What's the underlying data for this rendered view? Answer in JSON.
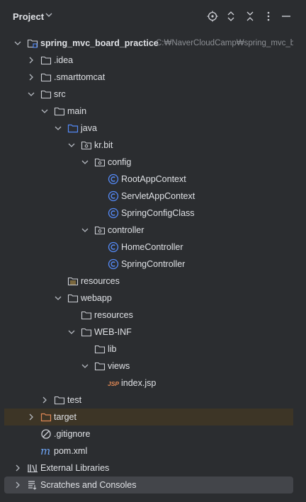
{
  "header": {
    "title": "Project",
    "icons": [
      "locate-icon",
      "expand-collapse-icon",
      "collapse-all-icon",
      "more-options-icon",
      "minimize-icon"
    ]
  },
  "tree": [
    {
      "label": "spring_mvc_board_practice",
      "path": "C:₩NaverCloudCamp₩spring_mvc_board_practice",
      "icon": "module-folder-icon",
      "arrow": "down",
      "depth": 0,
      "bold": true
    },
    {
      "label": ".idea",
      "icon": "folder-icon",
      "arrow": "right",
      "depth": 1
    },
    {
      "label": ".smarttomcat",
      "icon": "folder-icon",
      "arrow": "right",
      "depth": 1
    },
    {
      "label": "src",
      "icon": "folder-icon",
      "arrow": "down",
      "depth": 1
    },
    {
      "label": "main",
      "icon": "folder-icon",
      "arrow": "down",
      "depth": 2
    },
    {
      "label": "java",
      "icon": "source-folder-icon",
      "arrow": "down",
      "depth": 3
    },
    {
      "label": "kr.bit",
      "icon": "package-icon",
      "arrow": "down",
      "depth": 4
    },
    {
      "label": "config",
      "icon": "package-icon",
      "arrow": "down",
      "depth": 5
    },
    {
      "label": "RootAppContext",
      "icon": "class-icon",
      "arrow": "none",
      "depth": 6
    },
    {
      "label": "ServletAppContext",
      "icon": "class-icon",
      "arrow": "none",
      "depth": 6
    },
    {
      "label": "SpringConfigClass",
      "icon": "class-icon",
      "arrow": "none",
      "depth": 6
    },
    {
      "label": "controller",
      "icon": "package-icon",
      "arrow": "down",
      "depth": 5
    },
    {
      "label": "HomeController",
      "icon": "class-icon",
      "arrow": "none",
      "depth": 6
    },
    {
      "label": "SpringController",
      "icon": "class-icon",
      "arrow": "none",
      "depth": 6
    },
    {
      "label": "resources",
      "icon": "resources-folder-icon",
      "arrow": "none",
      "depth": 3
    },
    {
      "label": "webapp",
      "icon": "folder-icon",
      "arrow": "down",
      "depth": 3
    },
    {
      "label": "resources",
      "icon": "folder-icon",
      "arrow": "none",
      "depth": 4
    },
    {
      "label": "WEB-INF",
      "icon": "folder-icon",
      "arrow": "down",
      "depth": 4
    },
    {
      "label": "lib",
      "icon": "folder-icon",
      "arrow": "none",
      "depth": 5
    },
    {
      "label": "views",
      "icon": "folder-icon",
      "arrow": "down",
      "depth": 5
    },
    {
      "label": "index.jsp",
      "icon": "jsp-file-icon",
      "arrow": "none",
      "depth": 6
    },
    {
      "label": "test",
      "icon": "folder-icon",
      "arrow": "right",
      "depth": 2
    },
    {
      "label": "target",
      "icon": "excluded-folder-icon",
      "arrow": "right",
      "depth": 1,
      "highlight": true
    },
    {
      "label": ".gitignore",
      "icon": "ignore-file-icon",
      "arrow": "none",
      "depth": 1
    },
    {
      "label": "pom.xml",
      "icon": "maven-icon",
      "arrow": "none",
      "depth": 1
    },
    {
      "label": "External Libraries",
      "icon": "libraries-icon",
      "arrow": "right",
      "depth": 0
    },
    {
      "label": "Scratches and Consoles",
      "icon": "scratches-icon",
      "arrow": "right",
      "depth": 0,
      "selected": true
    }
  ],
  "colors": {
    "background": "#2b2d30",
    "text": "#dfe1e5",
    "path_text": "#8c8f94",
    "class_icon": "#548af7",
    "source_folder": "#548af7",
    "excluded_folder": "#e08855",
    "jsp_icon": "#e08855",
    "selection": "#43454a",
    "highlight_row": "#3d3526"
  }
}
